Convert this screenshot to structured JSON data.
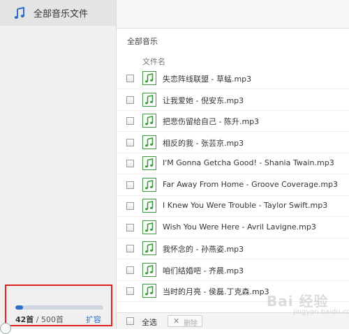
{
  "sidebar": {
    "item_label": "全部音乐文件",
    "quota": {
      "used": "42首",
      "separator": " / ",
      "total": "500首",
      "expand_link": "扩容",
      "used_fraction": 0.084
    }
  },
  "main": {
    "section_title": "全部音乐",
    "column_header": "文件名",
    "files": [
      "失恋阵线联盟 - 草蜢.mp3",
      "让我爱她 - 倪安东.mp3",
      "把悲伤留给自己 - 陈升.mp3",
      "相反的我 - 张芸京.mp3",
      "I'M Gonna Getcha Good! - Shania Twain.mp3",
      "Far Away From Home - Groove Coverage.mp3",
      "I Knew You Were Trouble - Taylor Swift.mp3",
      "Wish You Were Here - Avril Lavigne.mp3",
      "我怀念的 - 孙燕姿.mp3",
      "咱们结婚吧 - 齐晨.mp3",
      "当时的月亮 - 侯磊.丁克森.mp3"
    ]
  },
  "bottom": {
    "select_all": "全选",
    "delete_label": "删除"
  },
  "watermark": {
    "text": "Bai 经验",
    "sub": "jingyan.baidu.com"
  },
  "colors": {
    "accent": "#2b6fca",
    "file_icon": "#3b9a3b",
    "highlight": "#e02020"
  }
}
